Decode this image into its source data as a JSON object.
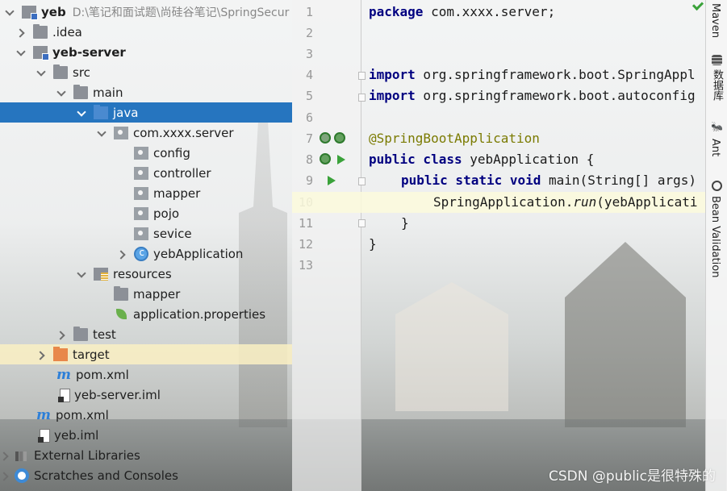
{
  "project_tree": {
    "rows": [
      {
        "label": "yeb",
        "path": "D:\\笔记和面试题\\尚硅谷笔记\\SpringSecur",
        "bold": true
      },
      {
        "label": ".idea"
      },
      {
        "label": "yeb-server",
        "bold": true
      },
      {
        "label": "src"
      },
      {
        "label": "main"
      },
      {
        "label": "java"
      },
      {
        "label": "com.xxxx.server"
      },
      {
        "label": "config"
      },
      {
        "label": "controller"
      },
      {
        "label": "mapper"
      },
      {
        "label": "pojo"
      },
      {
        "label": "sevice"
      },
      {
        "label": "yebApplication"
      },
      {
        "label": "resources"
      },
      {
        "label": "mapper"
      },
      {
        "label": "application.properties"
      },
      {
        "label": "test"
      },
      {
        "label": "target"
      },
      {
        "label": "pom.xml"
      },
      {
        "label": "yeb-server.iml"
      },
      {
        "label": "pom.xml"
      },
      {
        "label": "yeb.iml"
      },
      {
        "label": "External Libraries"
      },
      {
        "label": "Scratches and Consoles"
      }
    ]
  },
  "editor": {
    "line_numbers": [
      "1",
      "2",
      "3",
      "4",
      "5",
      "6",
      "7",
      "8",
      "9",
      "10",
      "11",
      "12",
      "13"
    ],
    "lines": {
      "l1_kw": "package",
      "l1_rest": " com.xxxx.server;",
      "l4_kw": "import",
      "l4_rest": " org.springframework.boot.SpringAppl",
      "l5_kw": "import",
      "l5_rest": " org.springframework.boot.autoconfig",
      "l7_ann": "@SpringBootApplication",
      "l8_kw": "public class",
      "l8_rest": " yebApplication {",
      "l9_kw": "public static void",
      "l9_rest": " main(String[] args)",
      "l10_a": "SpringApplication.",
      "l10_it": "run",
      "l10_b": "(yebApplicati",
      "l11": "}",
      "l12": "}"
    }
  },
  "toolstrip": {
    "maven": "Maven",
    "database": "数据库",
    "ant": "Ant",
    "bean_validation": "Bean Validation"
  },
  "watermark": "CSDN @public是很特殊的",
  "icons": {
    "folder": "folder-icon",
    "source_folder": "source-folder-icon",
    "package": "package-icon",
    "class": "class-icon",
    "spring": "spring-leaf-icon",
    "maven": "maven-icon",
    "iml": "module-file-icon",
    "run": "run-gutter-icon",
    "bean": "spring-bean-icon"
  },
  "colors": {
    "selection": "#2675bf",
    "keyword": "#000080",
    "annotation": "#7a7a00",
    "run_green": "#3aa23a"
  }
}
